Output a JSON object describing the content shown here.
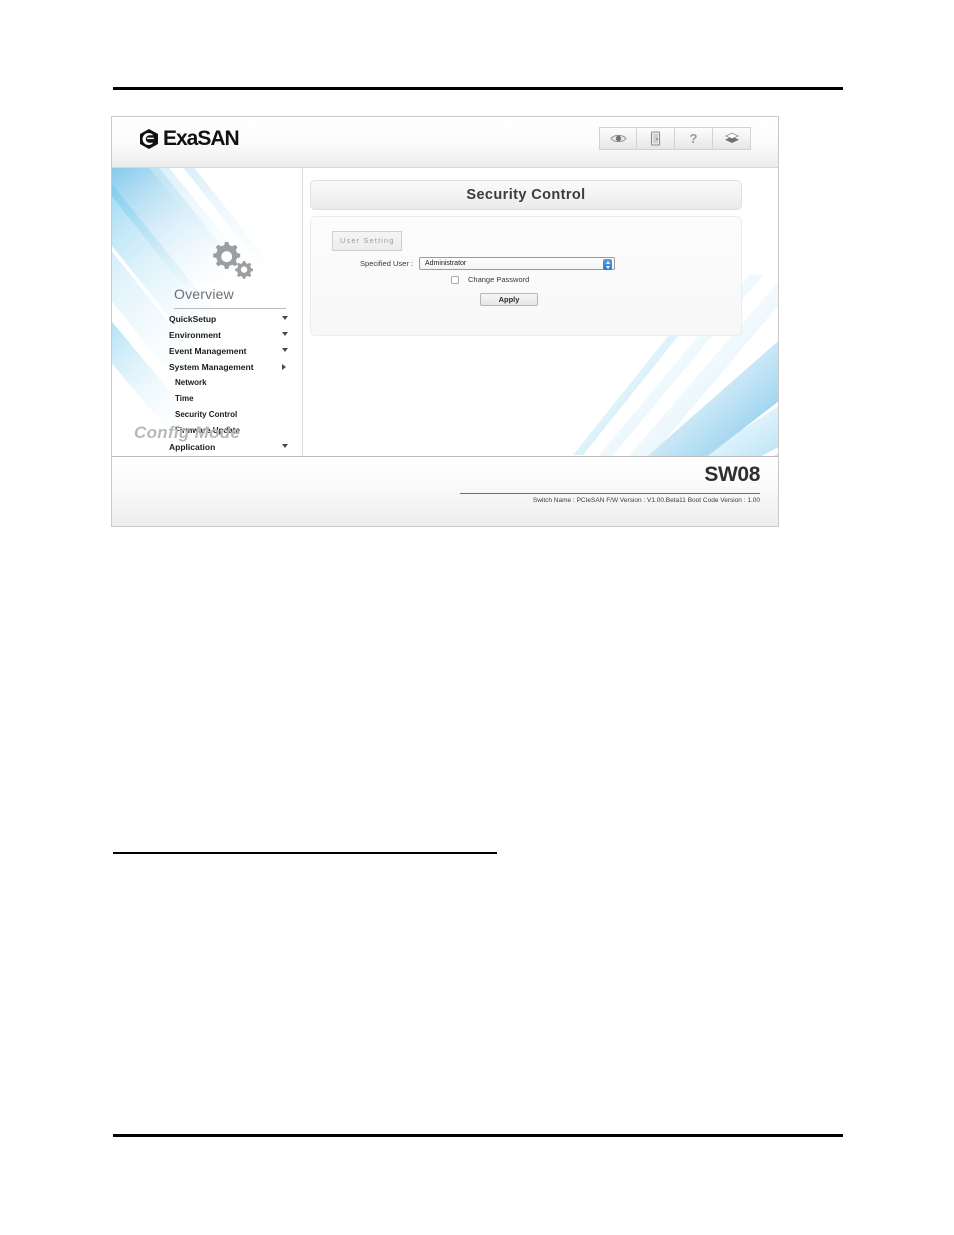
{
  "header": {
    "brand_name": "ExaSAN",
    "brand_mark_icon": "exasan-cube-logo-icon",
    "tools": [
      {
        "icon": "eye-icon",
        "name": "monitor-view-button"
      },
      {
        "icon": "door-logout-icon",
        "name": "logout-button"
      },
      {
        "icon": "question-mark-icon",
        "name": "help-button",
        "glyph": "?"
      },
      {
        "icon": "layers-stack-icon",
        "name": "stack-view-button"
      }
    ]
  },
  "sidebar": {
    "gear_icon": "gears-icon",
    "title": "Overview",
    "mode_label": "Config Mode",
    "items": [
      {
        "label": "QuickSetup",
        "arrow": "down",
        "level": "top"
      },
      {
        "label": "Environment",
        "arrow": "down",
        "level": "top"
      },
      {
        "label": "Event Management",
        "arrow": "down",
        "level": "top"
      },
      {
        "label": "System Management",
        "arrow": "right",
        "level": "top"
      },
      {
        "label": "Network",
        "arrow": "none",
        "level": "sub"
      },
      {
        "label": "Time",
        "arrow": "none",
        "level": "sub"
      },
      {
        "label": "Security Control",
        "arrow": "none",
        "level": "sub"
      },
      {
        "label": "Firmware Update",
        "arrow": "none",
        "level": "sub"
      },
      {
        "label": "Application",
        "arrow": "down",
        "level": "top"
      }
    ]
  },
  "content": {
    "page_title": "Security Control",
    "tab_label": "User Setting",
    "specified_user_label": "Specified User :",
    "specified_user_value": "Administrator",
    "specified_user_options": [
      "Administrator"
    ],
    "change_password_label": "Change Password",
    "change_password_checked": false,
    "apply_label": "Apply"
  },
  "footer": {
    "model": "SW08",
    "status": "Switch Name : PCIeSAN  F/W Version : V1.00.Beta11  Boot Code Version : 1.00"
  },
  "colors": {
    "accent_blue": "#2b7cd3",
    "streak_blue": "#27a8e0",
    "panel_gray": "#ededed"
  }
}
